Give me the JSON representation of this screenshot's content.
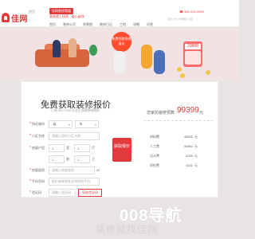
{
  "header": {
    "logo_text": "佳网",
    "top_link": "首页",
    "tag": "佳网装修频道",
    "tagline": "装修就上佳网 · 省心省钱",
    "contact": "☎ 400-000-0000",
    "nav_small": "装修公司 | 效果图 | 问答",
    "menu": [
      "首页",
      "装修公司",
      "效果图",
      "装修日记",
      "工地",
      "攻略",
      "问答"
    ]
  },
  "hero": {
    "bubble_text": "免费领取装修报价",
    "calculator_display": "29888"
  },
  "form": {
    "title": "免费获取装修报价",
    "subtitle": "已有 4677764 位业主获取装修报价",
    "fields": {
      "city_label": "所在城市",
      "province_value": "-省-",
      "city_value": "-市-",
      "community_label": "小区名称",
      "community_placeholder": "请输入您的小区名称",
      "layout_label": "房屋户型",
      "rooms_value": "1",
      "rooms_unit": "室",
      "halls_value": "1",
      "halls_unit": "厅",
      "kitchens_value": "1",
      "kitchens_unit": "厨",
      "baths_value": "1",
      "baths_unit": "卫",
      "area_label": "房屋面积",
      "area_placeholder": "请输入房屋面积",
      "area_unit": "㎡",
      "phone_label": "手机号码",
      "phone_placeholder": "报价结果将发送到您的手机",
      "code_label": "验证码",
      "code_placeholder": "请输入验证码",
      "code_button": "获取验证码"
    },
    "submit_label": "获取报价"
  },
  "budget": {
    "label": "您家的装修预算",
    "value": "99399",
    "unit": "元",
    "items": [
      {
        "name": "材料费",
        "value": "46665",
        "unit": "元"
      },
      {
        "name": "人工费",
        "value": "46864",
        "unit": "元"
      },
      {
        "name": "设计费",
        "value": "4339",
        "unit": "元"
      },
      {
        "name": "质检费",
        "value": "1631",
        "unit": "元"
      }
    ]
  },
  "footer": {
    "brand": "008导航",
    "sub": "装修就找佳网"
  },
  "colors": {
    "accent": "#e23b3b",
    "background": "#e9e4e4"
  }
}
